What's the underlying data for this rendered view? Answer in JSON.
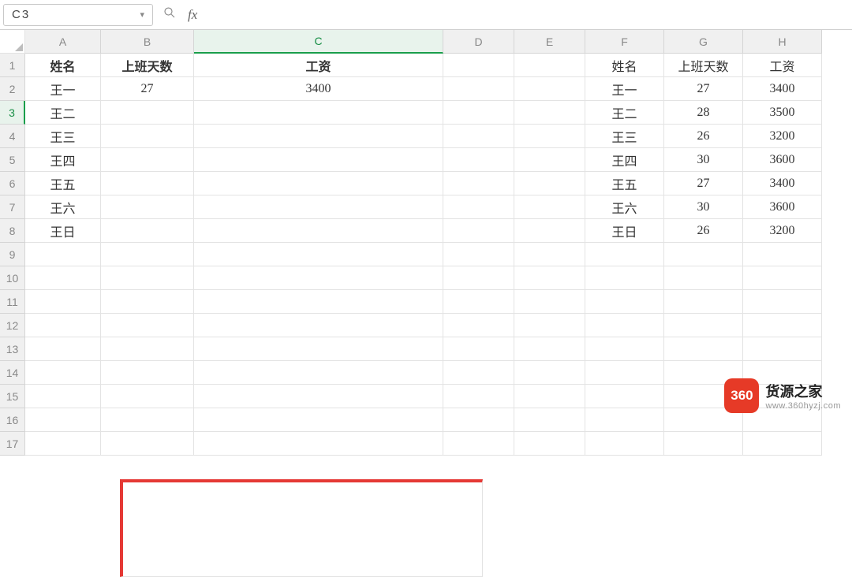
{
  "nameBox": {
    "value": "C3"
  },
  "formulaBar": {
    "value": ""
  },
  "columns": [
    "A",
    "B",
    "C",
    "D",
    "E",
    "F",
    "G",
    "H"
  ],
  "rows": [
    1,
    2,
    3,
    4,
    5,
    6,
    7,
    8,
    9,
    10,
    11,
    12,
    13,
    14,
    15,
    16,
    17
  ],
  "selectedColumn": "C",
  "selectedRow": 3,
  "leftTable": {
    "headers": {
      "name": "姓名",
      "days": "上班天数",
      "salary": "工资"
    },
    "r2": {
      "name": "王一",
      "days": "27",
      "salary": "3400"
    },
    "r3": {
      "name": "王二"
    },
    "r4": {
      "name": "王三"
    },
    "r5": {
      "name": "王四"
    },
    "r6": {
      "name": "王五"
    },
    "r7": {
      "name": "王六"
    },
    "r8": {
      "name": "王日"
    }
  },
  "rightTable": {
    "headers": {
      "name": "姓名",
      "days": "上班天数",
      "salary": "工资"
    },
    "rows": [
      {
        "name": "王一",
        "days": "27",
        "salary": "3400"
      },
      {
        "name": "王二",
        "days": "28",
        "salary": "3500"
      },
      {
        "name": "王三",
        "days": "26",
        "salary": "3200"
      },
      {
        "name": "王四",
        "days": "30",
        "salary": "3600"
      },
      {
        "name": "王五",
        "days": "27",
        "salary": "3400"
      },
      {
        "name": "王六",
        "days": "30",
        "salary": "3600"
      },
      {
        "name": "王日",
        "days": "26",
        "salary": "3200"
      }
    ]
  },
  "watermark": {
    "badge": "360",
    "title": "货源之家",
    "url": "www.360hyzj.com"
  },
  "chart_data": {
    "type": "table",
    "title": "",
    "tables": [
      {
        "range": "A1:C8",
        "columns": [
          "姓名",
          "上班天数",
          "工资"
        ],
        "rows": [
          [
            "王一",
            "27",
            "3400"
          ],
          [
            "王二",
            "",
            ""
          ],
          [
            "王三",
            "",
            ""
          ],
          [
            "王四",
            "",
            ""
          ],
          [
            "王五",
            "",
            ""
          ],
          [
            "王六",
            "",
            ""
          ],
          [
            "王日",
            "",
            ""
          ]
        ]
      },
      {
        "range": "F1:H8",
        "columns": [
          "姓名",
          "上班天数",
          "工资"
        ],
        "rows": [
          [
            "王一",
            "27",
            "3400"
          ],
          [
            "王二",
            "28",
            "3500"
          ],
          [
            "王三",
            "26",
            "3200"
          ],
          [
            "王四",
            "30",
            "3600"
          ],
          [
            "王五",
            "27",
            "3400"
          ],
          [
            "王六",
            "30",
            "3600"
          ],
          [
            "王日",
            "26",
            "3200"
          ]
        ]
      }
    ],
    "active_cell": "C3",
    "highlight_box": "B1:C4"
  }
}
